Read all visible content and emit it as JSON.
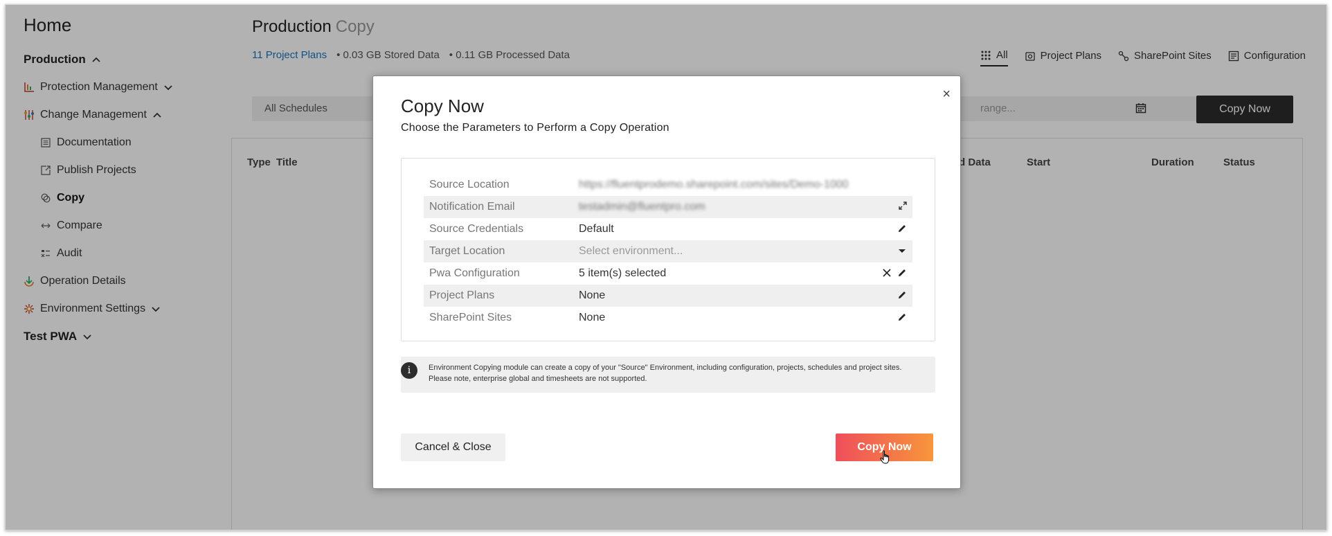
{
  "sidebar": {
    "home": "Home",
    "production": "Production",
    "items": [
      {
        "label": "Protection Management"
      },
      {
        "label": "Change Management"
      },
      {
        "label": "Documentation"
      },
      {
        "label": "Publish Projects"
      },
      {
        "label": "Copy"
      },
      {
        "label": "Compare"
      },
      {
        "label": "Audit"
      },
      {
        "label": "Operation Details"
      },
      {
        "label": "Environment Settings"
      }
    ],
    "test_pwa": "Test PWA"
  },
  "main": {
    "title": "Production",
    "title_sub": "Copy",
    "stats": {
      "plans_link": "11 Project Plans",
      "stored": "• 0.03 GB Stored Data",
      "processed": "• 0.11 GB Processed Data"
    },
    "views": [
      "All",
      "Project Plans",
      "SharePoint Sites",
      "Configuration"
    ],
    "filter": {
      "schedule": "All Schedules",
      "range_placeholder": "range..."
    },
    "copy_now_label": "Copy Now",
    "table_headers": [
      "Type",
      "Title",
      "d Data",
      "Start",
      "Duration",
      "Status"
    ]
  },
  "modal": {
    "title": "Copy Now",
    "subtitle": "Choose the Parameters to Perform a Copy Operation",
    "close": "×",
    "params": [
      {
        "label": "Source Location",
        "value": "https://fluentprodemo.sharepoint.com/sites/Demo-1000"
      },
      {
        "label": "Notification Email",
        "value": "testadmin@fluentpro.com"
      },
      {
        "label": "Source Credentials",
        "value": "Default"
      },
      {
        "label": "Target Location",
        "value": "Select environment..."
      },
      {
        "label": "Pwa Configuration",
        "value": "5 item(s) selected"
      },
      {
        "label": "Project Plans",
        "value": "None"
      },
      {
        "label": "SharePoint Sites",
        "value": "None"
      }
    ],
    "info_text": "Environment Copying module can create a copy of your \"Source\" Environment, including configuration, projects, schedules and project sites. Please note, enterprise global and timesheets are not supported.",
    "info_icon": "i",
    "cancel_label": "Cancel & Close",
    "copy_label": "Copy Now"
  },
  "colors": {
    "accent_start": "#ef4e5b",
    "accent_end": "#f7963b",
    "link": "#1c75bc",
    "dark_button": "#2b2b2b"
  }
}
